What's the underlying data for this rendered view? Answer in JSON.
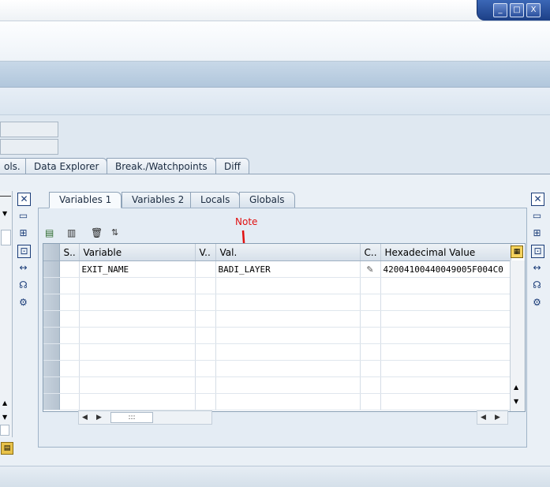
{
  "window": {
    "controls": [
      "_",
      "□",
      "X"
    ]
  },
  "outer_tabs": [
    {
      "label": "ols."
    },
    {
      "label": "Data Explorer"
    },
    {
      "label": "Break./Watchpoints"
    },
    {
      "label": "Diff"
    }
  ],
  "inner_tabs": [
    {
      "label": "Variables 1",
      "active": true
    },
    {
      "label": "Variables 2"
    },
    {
      "label": "Locals"
    },
    {
      "label": "Globals"
    }
  ],
  "annotation": {
    "text": "Note",
    "color": "#e01010"
  },
  "grid": {
    "columns": [
      {
        "label": "S.."
      },
      {
        "label": "Variable"
      },
      {
        "label": "V.."
      },
      {
        "label": "Val."
      },
      {
        "label": "C.."
      },
      {
        "label": "Hexadecimal Value"
      }
    ],
    "rows": [
      {
        "variable": "EXIT_NAME",
        "value": "BADI_LAYER",
        "hex": "42004100440049005F004C0"
      }
    ],
    "empty_rows": 8
  },
  "icons": {
    "toolbar": [
      "table-insert-icon",
      "table-new-icon",
      "delete-icon",
      "sort-icon"
    ],
    "side": [
      "close-icon",
      "new-icon",
      "tree-icon",
      "fullscreen-icon",
      "resize-icon",
      "headset-icon",
      "settings-icon"
    ],
    "edit": "pencil-icon",
    "layout": "grid-layout-icon"
  },
  "colors": {
    "accent": "#1c3f86",
    "annotation": "#e01010"
  }
}
